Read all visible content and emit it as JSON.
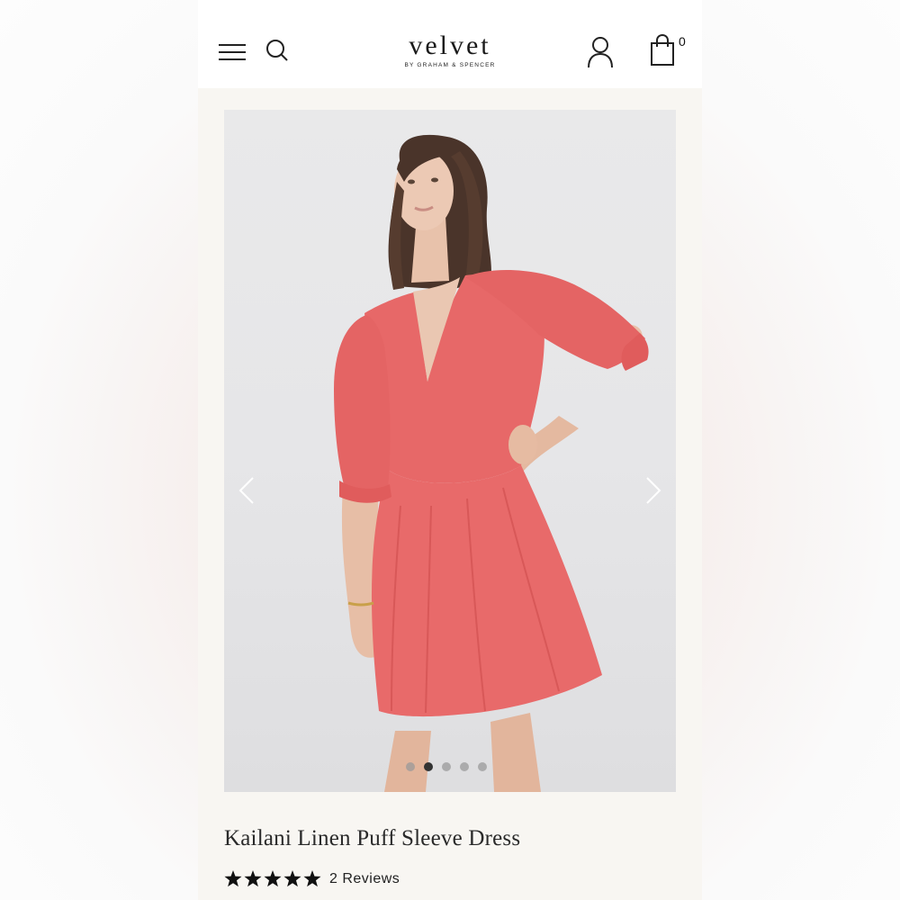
{
  "header": {
    "logo": "velvet",
    "logo_sub": "BY GRAHAM & SPENCER",
    "cart_count": "0",
    "icons": [
      "menu-icon",
      "search-icon",
      "account-icon",
      "shopping-bag-icon"
    ]
  },
  "gallery": {
    "image": "model wearing coral pink linen puff sleeve dress",
    "slide_count": 5,
    "active_slide": 2,
    "icons": [
      "chevron-left-icon",
      "chevron-right-icon"
    ]
  },
  "product": {
    "title": "Kailani Linen Puff Sleeve Dress",
    "rating": 5,
    "reviews": "2 Reviews"
  },
  "colors": {
    "dress": "#e86a6a",
    "background": "#f8f6f2"
  }
}
